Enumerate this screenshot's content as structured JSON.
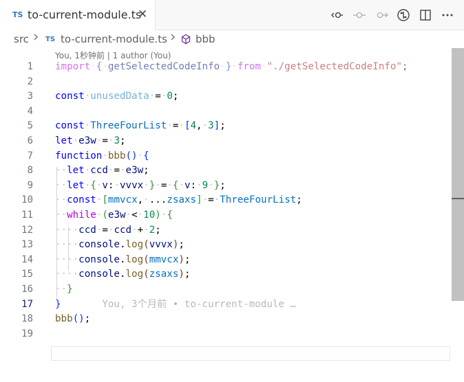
{
  "tab": {
    "lang_badge": "TS",
    "title": "to-current-module.ts",
    "close_glyph": "✕"
  },
  "actions": [
    "go-back-icon",
    "timeline-prev-icon",
    "timeline-next-icon",
    "git-compare-icon",
    "split-editor-icon",
    "more-actions-icon"
  ],
  "breadcrumb": {
    "folder": "src",
    "file_badge": "TS",
    "file": "to-current-module.ts",
    "symbol": "bbb"
  },
  "blame": {
    "header": "You, 1秒钟前 | 1 author (You)",
    "inline": "You, 3个月前 • to-current-module …"
  },
  "editor": {
    "current_line": 17,
    "line_numbers": [
      "1",
      "2",
      "3",
      "4",
      "5",
      "6",
      "7",
      "8",
      "9",
      "10",
      "11",
      "12",
      "13",
      "14",
      "15",
      "16",
      "17",
      "18",
      "19"
    ],
    "text": {
      "import": "import",
      "getSelectedCodeInfo": "getSelectedCodeInfo",
      "from": "from",
      "path": "\"./getSelectedCodeInfo\"",
      "const": "const",
      "let": "let",
      "function": "function",
      "while": "while",
      "unusedData": "unusedData",
      "ThreeFourList": "ThreeFourList",
      "e3w": "e3w",
      "bbb": "bbb",
      "ccd": "ccd",
      "v": "v",
      "vvvx": "vvvx",
      "mmvcx": "mmvcx",
      "zsaxs": "zsaxs",
      "console": "console",
      "log": "log",
      "n0": "0",
      "n4": "4",
      "n3": "3",
      "n9": "9",
      "n10": "10",
      "n2": "2",
      "spread": "..."
    }
  }
}
